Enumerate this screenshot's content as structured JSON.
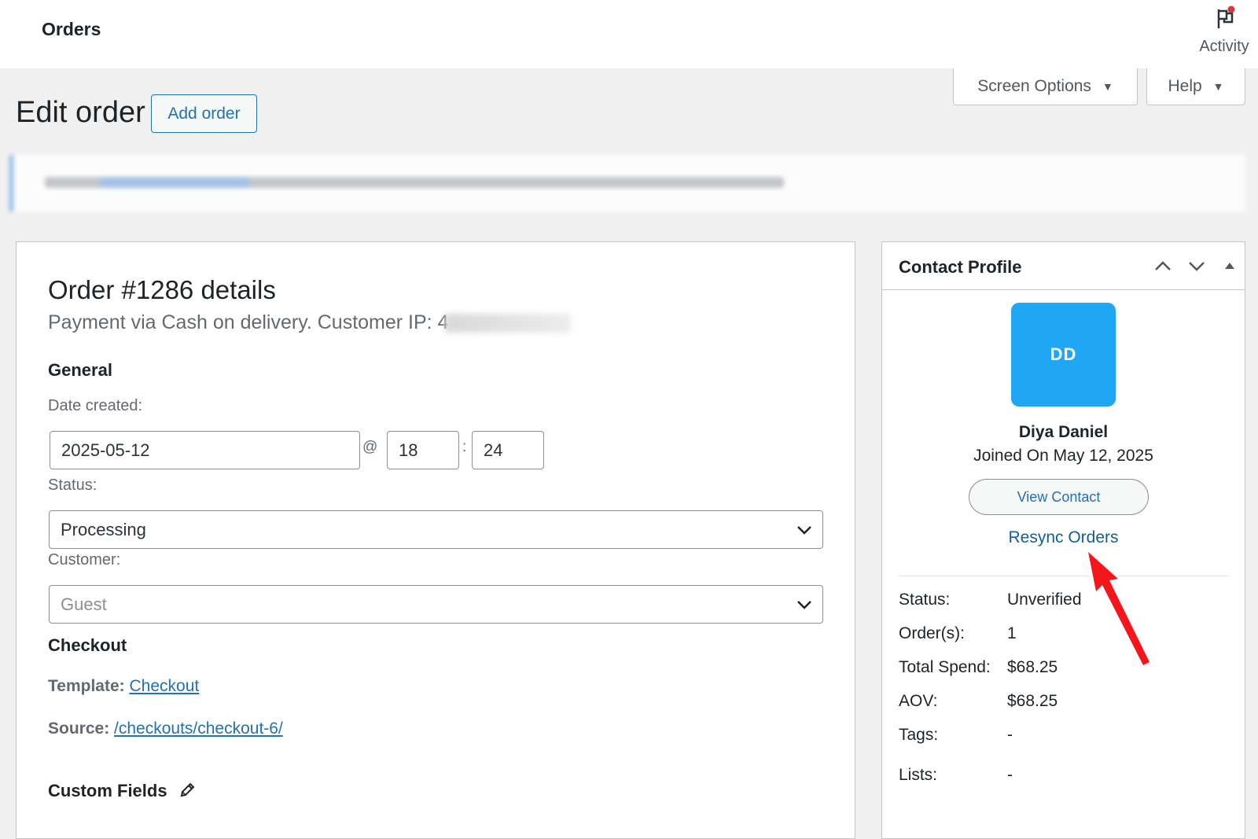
{
  "topbar": {
    "title": "Orders",
    "activity_label": "Activity"
  },
  "help_tabs": {
    "screen_options": "Screen Options",
    "help": "Help"
  },
  "heading": {
    "title": "Edit order",
    "add_order": "Add order"
  },
  "order": {
    "title": "Order #1286 details",
    "payment": "Payment via Cash on delivery. Customer IP: 4",
    "general_heading": "General",
    "date_label": "Date created:",
    "date_value": "2025-05-12",
    "at_symbol": "@",
    "hour": "18",
    "colon": ":",
    "minute": "24",
    "status_label": "Status:",
    "status_value": "Processing",
    "customer_label": "Customer:",
    "customer_value": "Guest",
    "checkout_heading": "Checkout",
    "template_label": "Template:",
    "template_value": "Checkout",
    "source_label": "Source:",
    "source_value": "/checkouts/checkout-6/",
    "custom_fields_heading": "Custom Fields"
  },
  "contact": {
    "title": "Contact Profile",
    "initials": "DD",
    "name": "Diya Daniel",
    "joined": "Joined On May 12, 2025",
    "view_contact": "View Contact",
    "resync_orders": "Resync Orders",
    "rows": [
      {
        "key": "Status:",
        "value": "Unverified"
      },
      {
        "key": "Order(s):",
        "value": "1"
      },
      {
        "key": "Total Spend:",
        "value": "$68.25"
      },
      {
        "key": "AOV:",
        "value": "$68.25"
      },
      {
        "key": "Tags:",
        "value": "-"
      },
      {
        "key": "Lists:",
        "value": "-"
      }
    ]
  },
  "colors": {
    "accent": "#2271b1",
    "avatar": "#1fa7f5",
    "annotation_arrow": "#f5161c"
  }
}
